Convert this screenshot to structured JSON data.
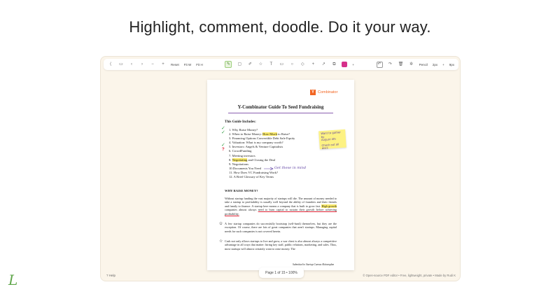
{
  "headline": "Highlight, comment, doodle. Do it your way.",
  "toolbar": {
    "reset_label": "Reset",
    "fit_width_label": "Fit W",
    "fit_height_label": "Fit H",
    "pencil_label": "Pencil",
    "pencil_size": "2px",
    "pencil_size_step": "+",
    "pencil_opacity": "9px",
    "active_color": "#d62f8a",
    "color_plus": "+"
  },
  "document": {
    "logo_letter": "Y",
    "logo_text": "Combinator",
    "title": "Y-Combinator Guide To Seed Fundraising",
    "includes_heading": "This Guide Includes:",
    "toc": [
      {
        "num": "1.",
        "pre": "Why Raise Money?",
        "hl": "",
        "post": ""
      },
      {
        "num": "2.",
        "pre": "When to Raise Money: ",
        "hl": "How Much",
        "post": " to Raise?"
      },
      {
        "num": "3.",
        "pre": "Financing Options Convertible Debt Safe Equity",
        "hl": "",
        "post": ""
      },
      {
        "num": "4.",
        "pre": "Valuation: What is my company worth?",
        "hl": "",
        "post": ""
      },
      {
        "num": "5.",
        "pre": "Investors: Angels & Venture Capitalists",
        "hl": "",
        "post": ""
      },
      {
        "num": "6.",
        "pre": "Crowd",
        "hl": "",
        "post": "Funding"
      },
      {
        "num": "7.",
        "pre": "Meeting investors",
        "hl": "",
        "post": ""
      },
      {
        "num": "8.",
        "pre": "",
        "hl": "Negotiating",
        "post": " and Closing the Deal"
      },
      {
        "num": "9.",
        "pre": "Negotiations",
        "hl": "",
        "post": ""
      },
      {
        "num": "10.",
        "pre": "Documents You Need",
        "hl": "",
        "post": ""
      },
      {
        "num": "11.",
        "pre": "How Does VC Fundraising Work?",
        "hl": "",
        "post": ""
      },
      {
        "num": "12.",
        "pre": "A Brief Glossary of Key Terms",
        "hl": "",
        "post": ""
      }
    ],
    "sticky_note": [
      "Want to gather by",
      "August 4th",
      "",
      "Check out all docs"
    ],
    "doodle_text": "Get these in mind",
    "section_heading": "WHY RAISE MONEY?",
    "para1_a": "Without startup funding the vast majority of startups will die. The amount of money needed to take a startup to profitability is usually well beyond the ability of founders and their friends and family to finance. A startup here means a company that is built to grow fast. ",
    "para1_hl": "High growth",
    "para1_b": " companies almost always ",
    "para1_ul": "need to burn capital to sustain their growth before achieving profitability.",
    "para2": "A few startup companies do successfully bootstrap (self-fund) themselves, but they are the exception. Of course, there are lots of great companies that aren't startups. Managing capital needs for such companies is not covered herein.",
    "para3": "Cash not only allows startups to live and grow, a war chest is also almost always a competitive advantage in all ways that matter: hiring key staff, public relations, marketing, and sales. Thus, most startups will almost certainly want to raise money. The",
    "footer_note": "Submitted to Startup Canvas Aktionsplan"
  },
  "pager": "Page 1 of 15 • 100%",
  "help": "? Help",
  "credits": "© Open-source PDF editor • Free, lightweight, private • Made by Rudi K",
  "brand_logo": "L"
}
